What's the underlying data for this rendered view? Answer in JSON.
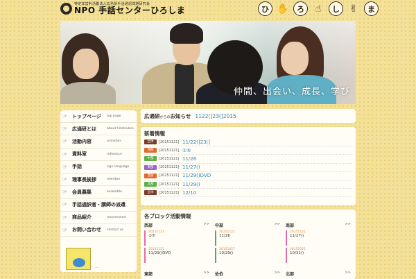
{
  "header": {
    "org_sub": "特定非営利活動法人広島県手話通訳問題研究会",
    "org_name": "NPO 手話センターひろしま",
    "hand_chars": [
      "ひ",
      "ろ",
      "し",
      "ま"
    ]
  },
  "hero": {
    "caption": "仲間、出会い、成長、学び"
  },
  "sidebar": {
    "items": [
      {
        "label": "トップページ",
        "en": "top page"
      },
      {
        "label": "広通研とは",
        "en": "about hirotsuken"
      },
      {
        "label": "活動内容",
        "en": "activities"
      },
      {
        "label": "資料室",
        "en": "reference"
      },
      {
        "label": "手話",
        "en": "sign language"
      },
      {
        "label": "理事長挨拶",
        "en": "member"
      },
      {
        "label": "会員募集",
        "en": "assemble"
      },
      {
        "label": "手話通訳者・講師の派遣",
        "en": ""
      },
      {
        "label": "商品紹介",
        "en": "recommend"
      },
      {
        "label": "お問い合わせ",
        "en": "contact us"
      }
    ],
    "banner_text": "..."
  },
  "notice": {
    "title": "広通研",
    "title_small": "からの",
    "title_end": "お知らせ",
    "link": "1122(]23(]2015"
  },
  "news": {
    "title": "新着情報",
    "items": [
      {
        "badge": "全体",
        "color": "#7a3a2a",
        "date": "[20151121]",
        "text": "11/22(]23(]"
      },
      {
        "badge": "西部",
        "color": "#e2662e",
        "date": "[20151121]",
        "text": "①⑤"
      },
      {
        "badge": "中部",
        "color": "#5cb04a",
        "date": "[20151121]",
        "text": "11/26"
      },
      {
        "badge": "東部",
        "color": "#9a63c4",
        "date": "[20151121]",
        "text": "11/27()"
      },
      {
        "badge": "西部",
        "color": "#e2662e",
        "date": "[20151121]",
        "text": "11/29()DVD"
      },
      {
        "badge": "北部",
        "color": "#5cb04a",
        "date": "[20151121]",
        "text": "11/29()"
      },
      {
        "badge": "全体",
        "color": "#7a3a2a",
        "date": "[20151121]",
        "text": "12/10"
      }
    ]
  },
  "blocks": {
    "title": "各ブロック活動情報",
    "more": ">>",
    "cols": [
      {
        "name": "西部",
        "entries": [
          {
            "date": "20151121",
            "text": "①⑤",
            "color": "pink"
          },
          {
            "date": "20151121",
            "text": "11/29()DVD",
            "color": "pink"
          }
        ]
      },
      {
        "name": "中部",
        "entries": [
          {
            "date": "20151121",
            "text": "11/26",
            "color": "green"
          },
          {
            "date": "20151027",
            "text": "10/29()",
            "color": "green"
          }
        ]
      },
      {
        "name": "南部",
        "entries": [
          {
            "date": "20151121",
            "text": "11/27()",
            "color": "pink"
          },
          {
            "date": "20151021",
            "text": "10/31()",
            "color": "pink"
          }
        ]
      }
    ],
    "row2": [
      "東部",
      "佐伯",
      "北部"
    ]
  }
}
